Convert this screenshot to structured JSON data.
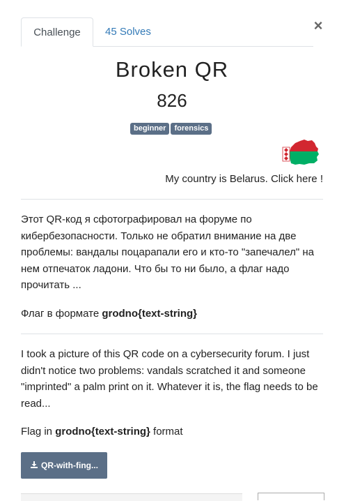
{
  "tabs": {
    "challenge": "Challenge",
    "solves": "45 Solves"
  },
  "close_label": "×",
  "challenge": {
    "name": "Broken QR",
    "points": "826",
    "tags": [
      "beginner",
      "forensics"
    ]
  },
  "country_link": "My country is Belarus. Click here !",
  "description_ru": {
    "text": "Этот QR-код я сфотографировал на форуме по кибербезопасности. Только не обратил внимание на две проблемы: вандалы поцарапали его и кто-то \"запечалел\" на нем отпечаток ладони. Что бы то ни было, а флаг надо прочитать ...",
    "flag_prefix": "Флаг в формате ",
    "flag_format": "grodno{text-string}"
  },
  "description_en": {
    "text": "I took a picture of this QR code on a cybersecurity forum. I just didn't notice two problems: vandals scratched it and someone \"imprinted\" a palm print on it. Whatever it is, the flag needs to be read...",
    "flag_prefix": "Flag in ",
    "flag_format": "grodno{text-string}",
    "flag_suffix": " format"
  },
  "download": {
    "label": "QR-with-fing...",
    "icon": "download-icon"
  },
  "colors": {
    "tag_bg": "#5b6f87",
    "link": "#337ab7",
    "flag_red": "#d22730",
    "flag_green": "#00af66"
  }
}
